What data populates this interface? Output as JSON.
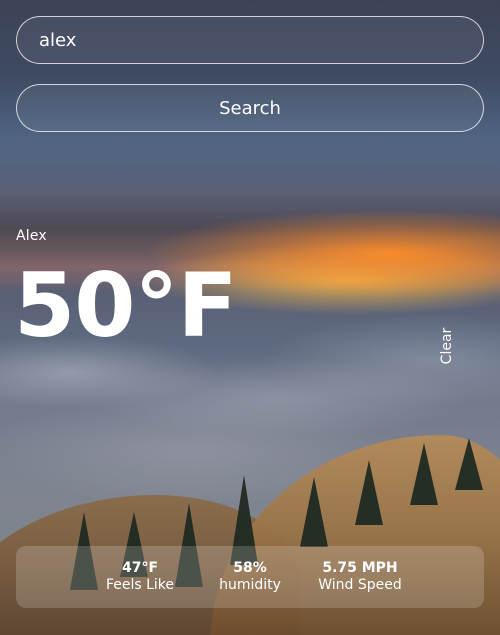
{
  "search": {
    "value": "alex",
    "button_label": "Search"
  },
  "weather": {
    "location": "Alex",
    "temperature": "50°F",
    "condition": "Clear"
  },
  "stats": [
    {
      "value": "47°F",
      "label": "Feels Like"
    },
    {
      "value": "58%",
      "label": "humidity"
    },
    {
      "value": "5.75 MPH",
      "label": "Wind Speed"
    }
  ]
}
